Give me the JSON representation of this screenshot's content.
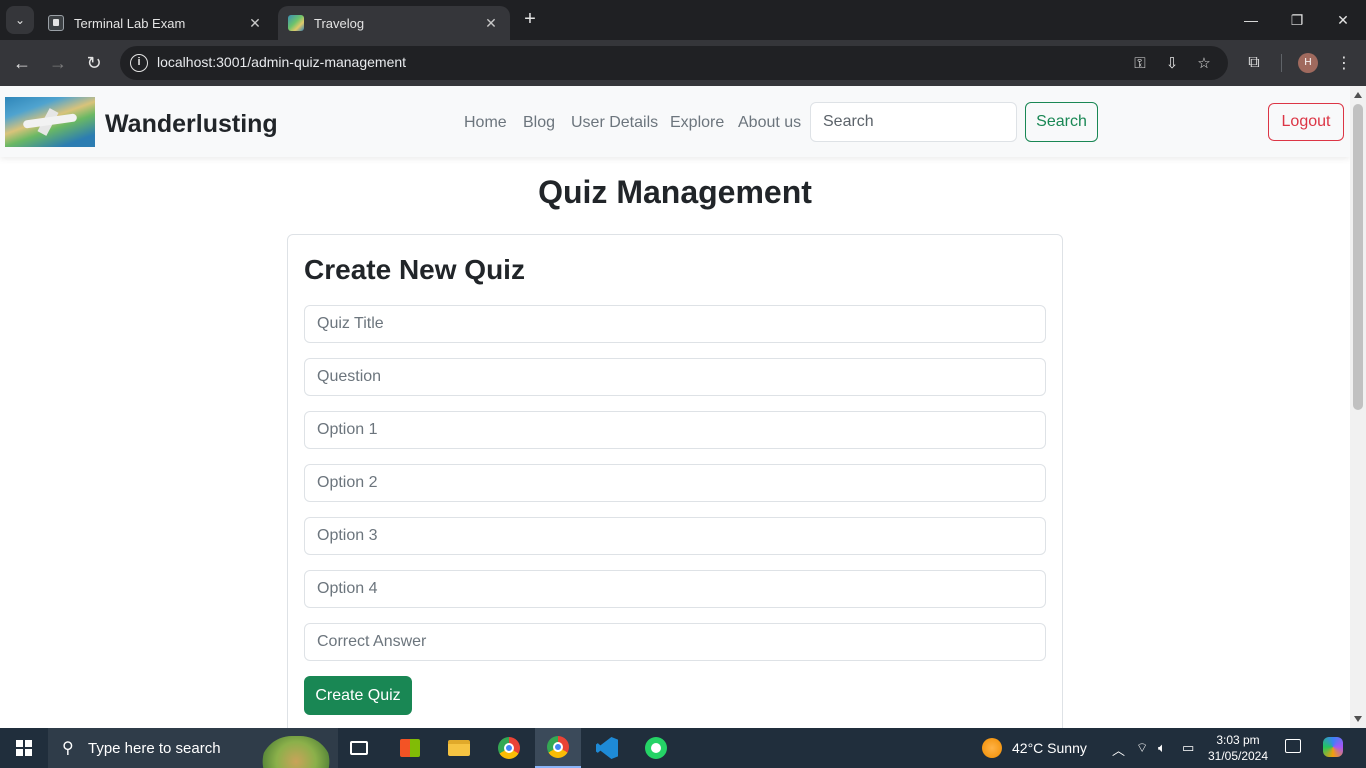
{
  "browser": {
    "tabs": [
      {
        "title": "Terminal Lab Exam",
        "active": false,
        "icon": "terminal-icon"
      },
      {
        "title": "Travelog",
        "active": true,
        "icon": "map-favicon-icon"
      }
    ],
    "url": "localhost:3001/admin-quiz-management"
  },
  "navbar": {
    "brand": "Wanderlusting",
    "links": [
      "Home",
      "Blog",
      "User Details",
      "Explore",
      "About us"
    ],
    "search_placeholder": "Search",
    "search_button": "Search",
    "logout_button": "Logout"
  },
  "page": {
    "title": "Quiz Management",
    "card_title": "Create New Quiz",
    "fields": {
      "quiz_title": "Quiz Title",
      "question": "Question",
      "option1": "Option 1",
      "option2": "Option 2",
      "option3": "Option 3",
      "option4": "Option 4",
      "correct_answer": "Correct Answer"
    },
    "submit_button": "Create Quiz"
  },
  "taskbar": {
    "search_text": "Type here to search",
    "weather": "42°C  Sunny",
    "time": "3:03 pm",
    "date": "31/05/2024"
  },
  "colors": {
    "success": "#198754",
    "danger": "#dc3545",
    "navbar_bg": "#f8f9fa",
    "chrome_dark": "#35363a"
  }
}
